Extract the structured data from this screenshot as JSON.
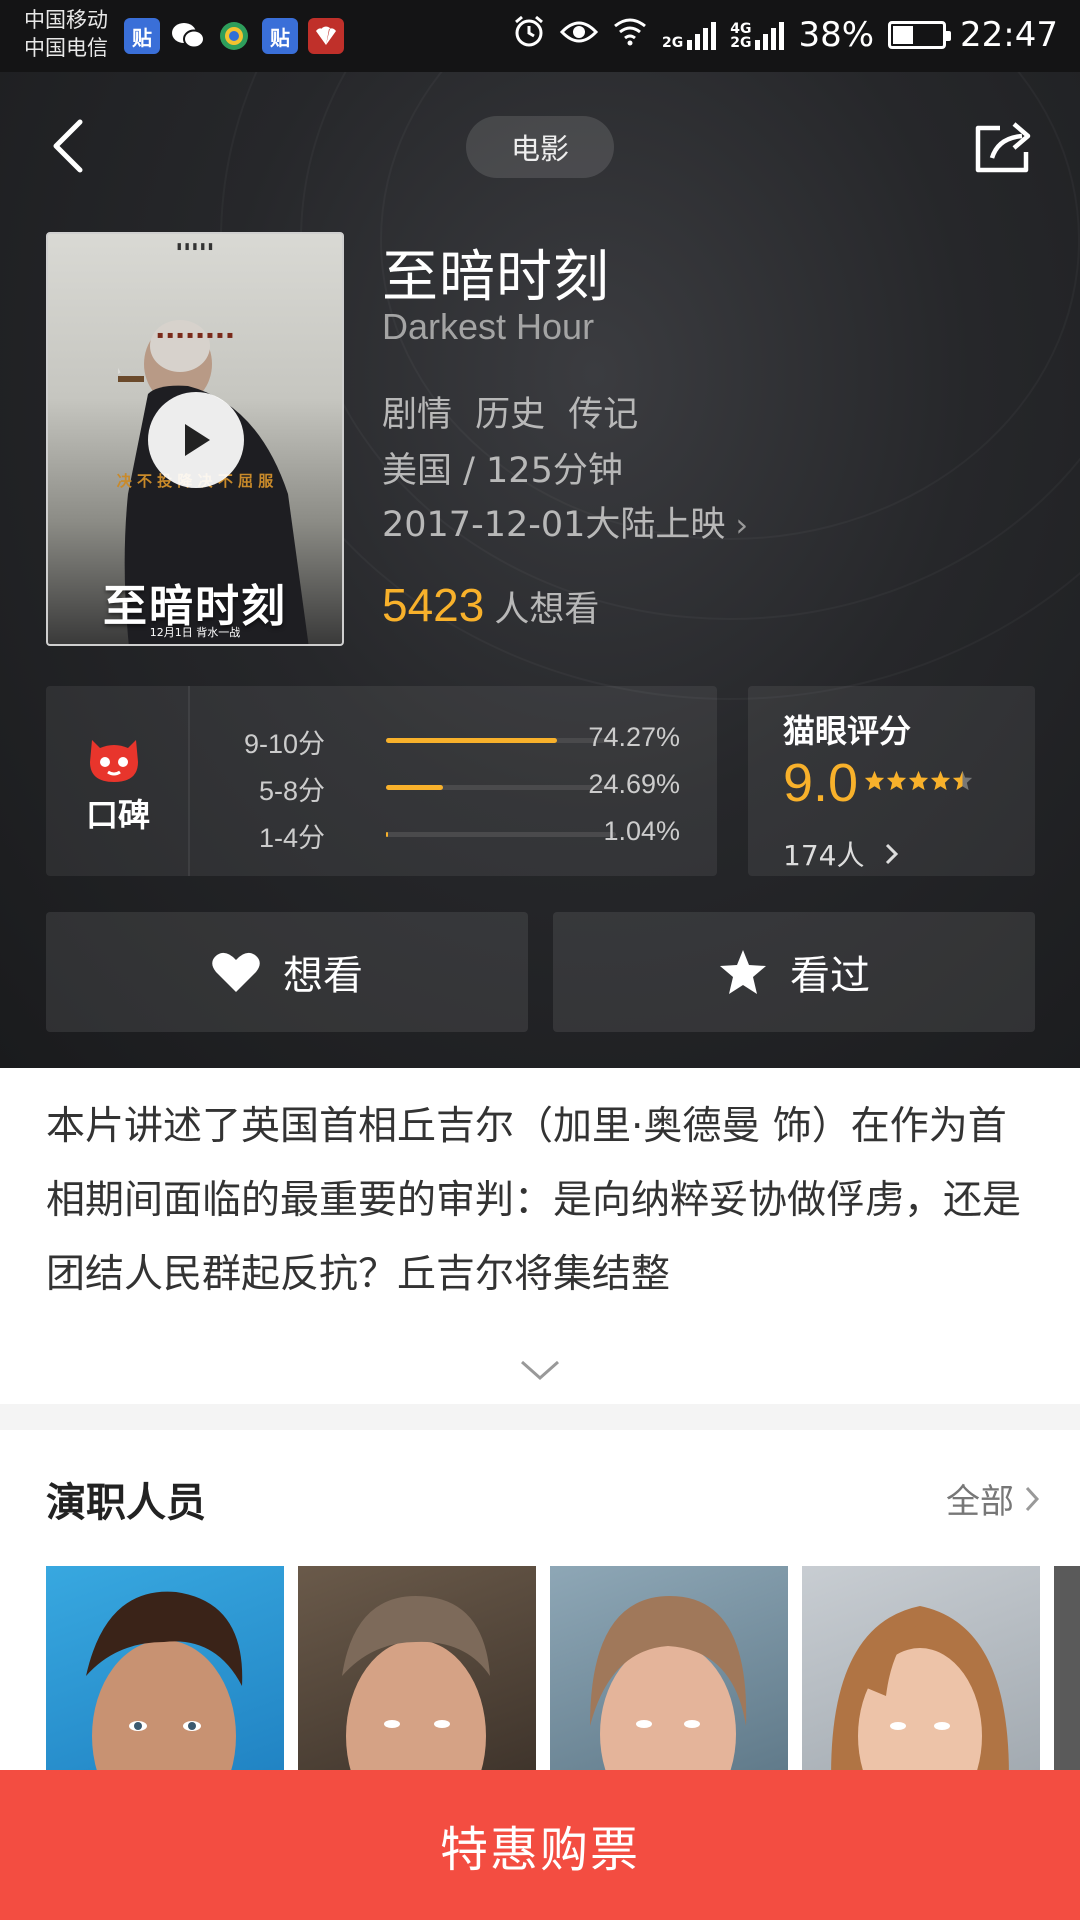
{
  "status_bar": {
    "carrier_1": "中国移动",
    "carrier_2": "中国电信",
    "notification_icons": [
      "tieba-icon",
      "wechat-icon",
      "browser-icon",
      "tieba-icon",
      "huawei-icon"
    ],
    "network_1": "2G",
    "network_2a": "4G",
    "network_2b": "2G",
    "battery": "38%",
    "battery_level": 0.38,
    "time": "22:47"
  },
  "nav": {
    "category": "电影"
  },
  "movie": {
    "title_cn": "至暗时刻",
    "title_en": "Darkest Hour",
    "genres": "剧情 历史 传记",
    "country_duration": "美国 / 125分钟",
    "release": "2017-12-01大陆上映",
    "want_count": "5423",
    "want_suffix": "人想看",
    "poster_title": "至暗时刻",
    "poster_tagline": "决 不 投 降   决 不 屈 服",
    "poster_release": "12月1日 背水一战"
  },
  "word_of_mouth": {
    "label": "口碑",
    "rows": [
      {
        "range": "9-10分",
        "percent": "74.27%",
        "fraction": 0.7427
      },
      {
        "range": "5-8分",
        "percent": "24.69%",
        "fraction": 0.2469
      },
      {
        "range": "1-4分",
        "percent": "1.04%",
        "fraction": 0.0104
      }
    ]
  },
  "maoyan_score": {
    "label": "猫眼评分",
    "score": "9.0",
    "stars": 4.5,
    "count": "174人"
  },
  "actions": {
    "want_label": "想看",
    "seen_label": "看过"
  },
  "synopsis": {
    "text": "本片讲述了英国首相丘吉尔（加里·奥德曼 饰）在作为首相期间面临的最重要的审判：是向纳粹妥协做俘虏，还是团结人民群起反抗？丘吉尔将集结整"
  },
  "cast": {
    "title": "演职人员",
    "all_label": "全部"
  },
  "buy": {
    "label": "特惠购票"
  },
  "colors": {
    "accent_yellow": "#f8b12b",
    "buy_red": "#f34d41",
    "maoyan_red": "#e8352c"
  }
}
